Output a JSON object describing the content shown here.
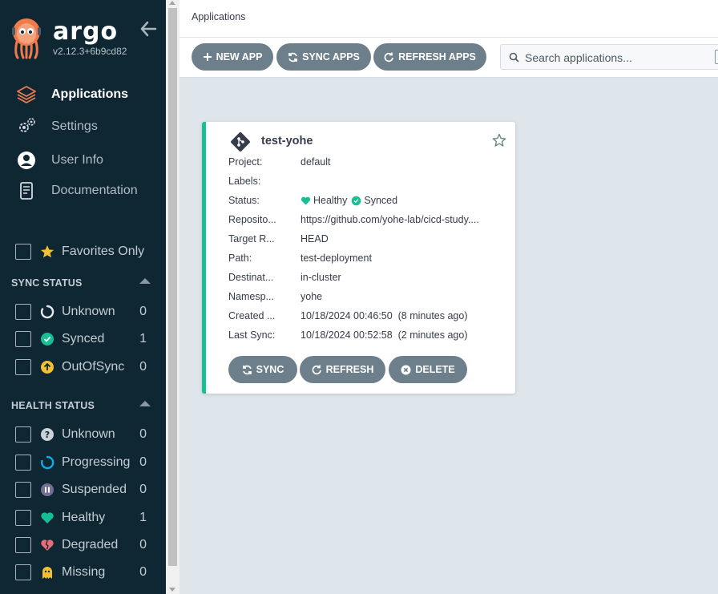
{
  "app": {
    "brand": "argo",
    "version": "v2.12.3+6b9cd82"
  },
  "nav": {
    "items": [
      {
        "label": "Applications",
        "icon": "layers-icon"
      },
      {
        "label": "Settings",
        "icon": "gears-icon"
      },
      {
        "label": "User Info",
        "icon": "user-circle-icon"
      },
      {
        "label": "Documentation",
        "icon": "book-icon"
      }
    ]
  },
  "filters": {
    "favorites_label": "Favorites Only",
    "sync_title": "SYNC STATUS",
    "sync": [
      {
        "label": "Unknown",
        "count": "0",
        "icon": "circle-notch-icon"
      },
      {
        "label": "Synced",
        "count": "1",
        "icon": "check-circle-icon"
      },
      {
        "label": "OutOfSync",
        "count": "0",
        "icon": "arrow-up-circle-icon"
      }
    ],
    "health_title": "HEALTH STATUS",
    "health": [
      {
        "label": "Unknown",
        "count": "0",
        "icon": "question-circle-icon"
      },
      {
        "label": "Progressing",
        "count": "0",
        "icon": "progress-circle-icon"
      },
      {
        "label": "Suspended",
        "count": "0",
        "icon": "pause-circle-icon"
      },
      {
        "label": "Healthy",
        "count": "1",
        "icon": "heart-icon"
      },
      {
        "label": "Degraded",
        "count": "0",
        "icon": "broken-heart-icon"
      },
      {
        "label": "Missing",
        "count": "0",
        "icon": "ghost-icon"
      }
    ]
  },
  "header": {
    "title": "Applications"
  },
  "toolbar": {
    "new_app": "NEW APP",
    "sync_apps": "SYNC APPS",
    "refresh_apps": "REFRESH APPS",
    "search_placeholder": "Search applications..."
  },
  "card": {
    "name": "test-yohe",
    "rows": [
      {
        "key": "Project:",
        "value": "default"
      },
      {
        "key": "Labels:",
        "value": ""
      },
      {
        "key": "Status:",
        "health": "Healthy",
        "sync": "Synced"
      },
      {
        "key": "Reposito...",
        "value": "https://github.com/yohe-lab/cicd-study...."
      },
      {
        "key": "Target R...",
        "value": "HEAD"
      },
      {
        "key": "Path:",
        "value": "test-deployment"
      },
      {
        "key": "Destinat...",
        "value": "in-cluster"
      },
      {
        "key": "Namesp...",
        "value": "yohe"
      },
      {
        "key": "Created ...",
        "value": "10/18/2024 00:46:50  (8 minutes ago)"
      },
      {
        "key": "Last Sync:",
        "value": "10/18/2024 00:52:58  (2 minutes ago)"
      }
    ],
    "sync_label": "SYNC",
    "refresh_label": "REFRESH",
    "delete_label": "DELETE"
  },
  "colors": {
    "sidebar": "#0f2733",
    "healthy": "#18be94",
    "button": "#6d7f8b",
    "accent_orange": "#ef7b4d"
  }
}
